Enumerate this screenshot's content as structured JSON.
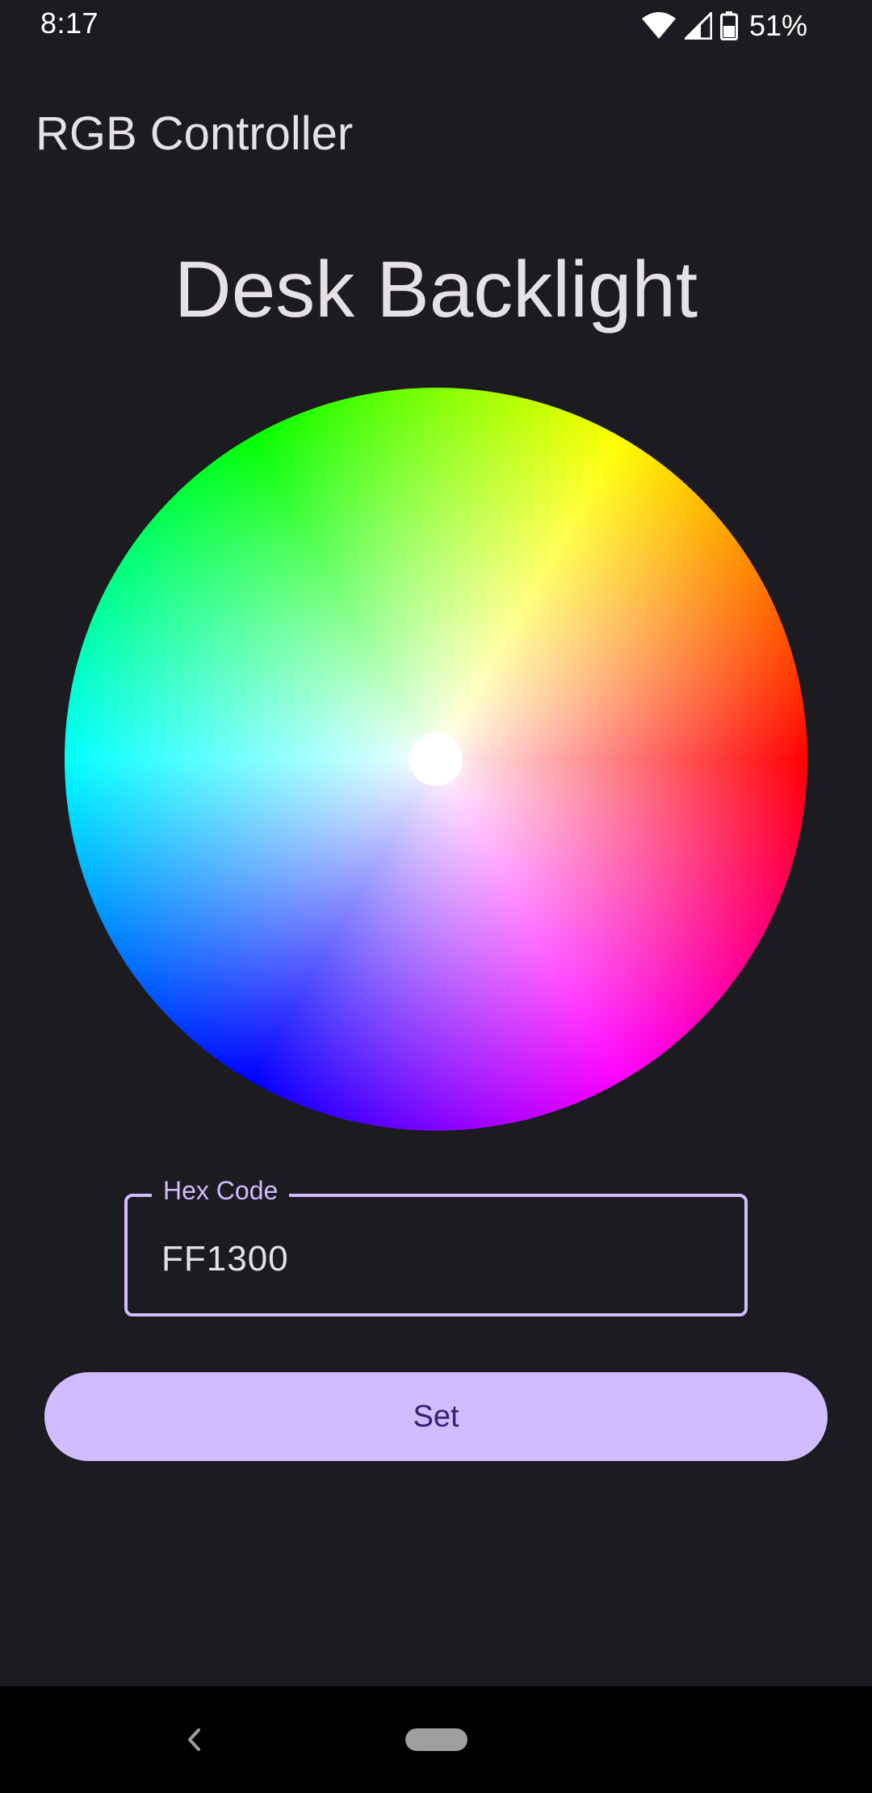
{
  "status_bar": {
    "time": "8:17",
    "battery": "51%",
    "icons": [
      "wifi-icon",
      "signal-icon",
      "battery-icon"
    ]
  },
  "app": {
    "title": "RGB Controller"
  },
  "device": {
    "name": "Desk Backlight"
  },
  "color_picker": {
    "type": "hue-saturation-wheel",
    "selected_color": "#FF1300"
  },
  "hex_input": {
    "label": "Hex Code",
    "value": "FF1300"
  },
  "set_button": {
    "label": "Set"
  },
  "navigation": {
    "icons": [
      "back-icon",
      "home-pill"
    ]
  },
  "colors": {
    "background": "#1c1b1f",
    "accent": "#d0bcff",
    "on_accent": "#381e72",
    "text": "#e6e1e5"
  }
}
